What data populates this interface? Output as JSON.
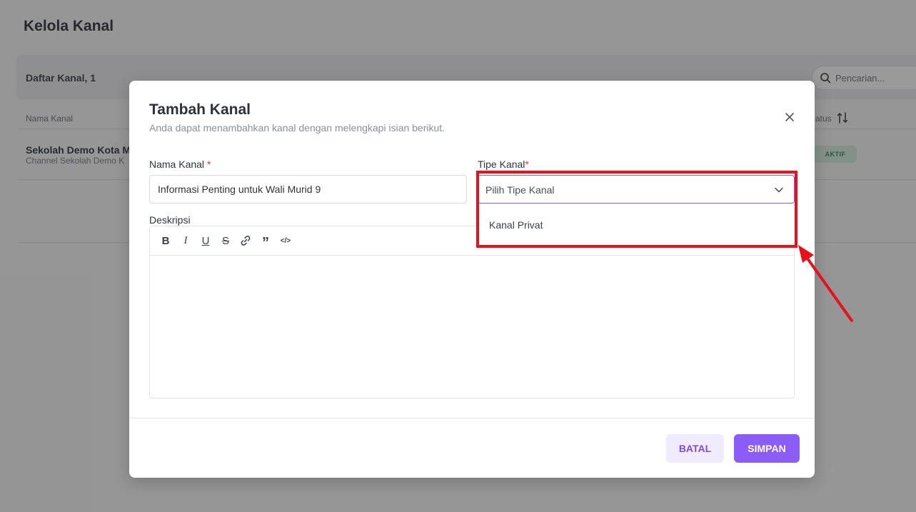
{
  "page": {
    "title": "Kelola Kanal",
    "list_title": "Daftar Kanal, 1",
    "search_placeholder": "Pencarian...",
    "columns": {
      "name": "Nama Kanal",
      "status": "atus"
    },
    "row": {
      "name": "Sekolah Demo Kota M",
      "description": "Channel Sekolah Demo K",
      "status": "AKTIF"
    }
  },
  "modal": {
    "title": "Tambah Kanal",
    "subtitle": "Anda dapat menambahkan kanal dengan melengkapi isian berikut.",
    "name_label": "Nama Kanal",
    "name_required": "*",
    "name_value": "Informasi Penting untuk Wali Murid 9",
    "type_label": "Tipe Kanal",
    "type_required": "*",
    "type_placeholder": "Pilih Tipe Kanal",
    "type_options": [
      "Kanal Privat"
    ],
    "description_label": "Deskripsi",
    "toolbar": {
      "bold": "B",
      "italic": "I",
      "underline": "U",
      "strike": "S",
      "quote": "”",
      "code": "</>"
    },
    "cancel_label": "BATAL",
    "save_label": "SIMPAN"
  },
  "colors": {
    "accent": "#8b5cf6",
    "highlight": "#e8101a",
    "status_active": "#2e8b57"
  },
  "icons": [
    "search-icon",
    "sort-icon",
    "close-icon",
    "chevron-down-icon",
    "link-icon"
  ]
}
